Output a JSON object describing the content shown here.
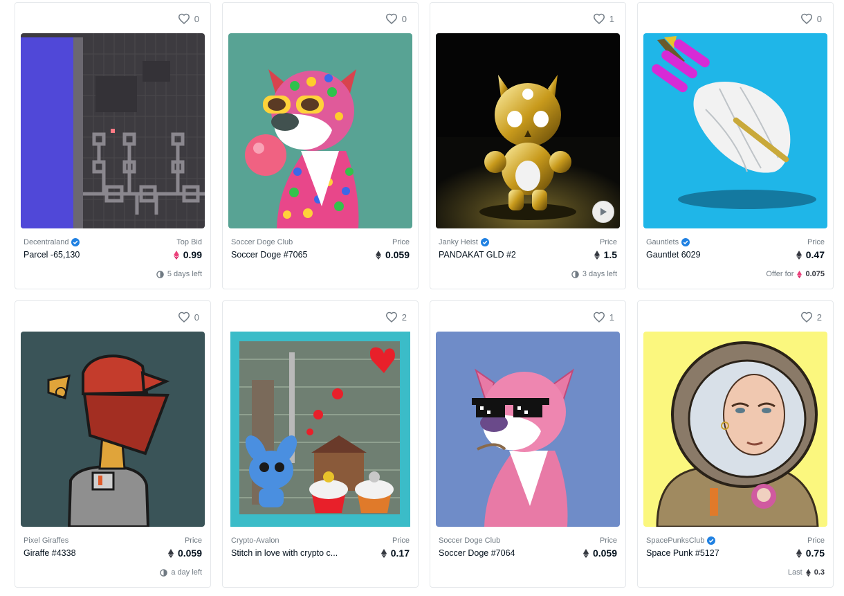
{
  "colors": {
    "eth": "#353840",
    "weth": "#ec407a",
    "verified": "#2081e2",
    "muted": "#707a83",
    "border": "#e5e8eb"
  },
  "icons": {
    "favorite": "heart-outline-icon",
    "verified": "verified-badge-icon",
    "eth": "ethereum-icon",
    "weth": "weth-icon",
    "time": "clock-icon",
    "play": "play-icon"
  },
  "cards": [
    {
      "favorites": "0",
      "collection": "Decentraland",
      "verified": true,
      "name": "Parcel -65,130",
      "price_label": "Top Bid",
      "price": "0.99",
      "currency": "weth",
      "footer_text": "5 days left",
      "footer_type": "time"
    },
    {
      "favorites": "0",
      "collection": "Soccer Doge Club",
      "verified": false,
      "name": "Soccer Doge #7065",
      "price_label": "Price",
      "price": "0.059",
      "currency": "eth",
      "footer_text": "",
      "footer_type": "none"
    },
    {
      "favorites": "1",
      "collection": "Janky Heist",
      "verified": true,
      "name": "PANDAKAT GLD #2",
      "price_label": "Price",
      "price": "1.5",
      "currency": "eth",
      "footer_text": "3 days left",
      "footer_type": "time",
      "has_video": true
    },
    {
      "favorites": "0",
      "collection": "Gauntlets",
      "verified": true,
      "name": "Gauntlet 6029",
      "price_label": "Price",
      "price": "0.47",
      "currency": "eth",
      "footer_text": "Offer for",
      "footer_value": "0.075",
      "footer_type": "offer"
    },
    {
      "favorites": "0",
      "collection": "Pixel Giraffes",
      "verified": false,
      "name": "Giraffe #4338",
      "price_label": "Price",
      "price": "0.059",
      "currency": "eth",
      "footer_text": "a day left",
      "footer_type": "time"
    },
    {
      "favorites": "2",
      "collection": "Crypto-Avalon",
      "verified": false,
      "name": "Stitch in love with crypto c...",
      "price_label": "Price",
      "price": "0.17",
      "currency": "eth",
      "footer_text": "",
      "footer_type": "none"
    },
    {
      "favorites": "1",
      "collection": "Soccer Doge Club",
      "verified": false,
      "name": "Soccer Doge #7064",
      "price_label": "Price",
      "price": "0.059",
      "currency": "eth",
      "footer_text": "",
      "footer_type": "none"
    },
    {
      "favorites": "2",
      "collection": "SpacePunksClub",
      "verified": true,
      "name": "Space Punk #5127",
      "price_label": "Price",
      "price": "0.75",
      "currency": "eth",
      "footer_text": "Last",
      "footer_value": "0.3",
      "footer_type": "last"
    }
  ]
}
